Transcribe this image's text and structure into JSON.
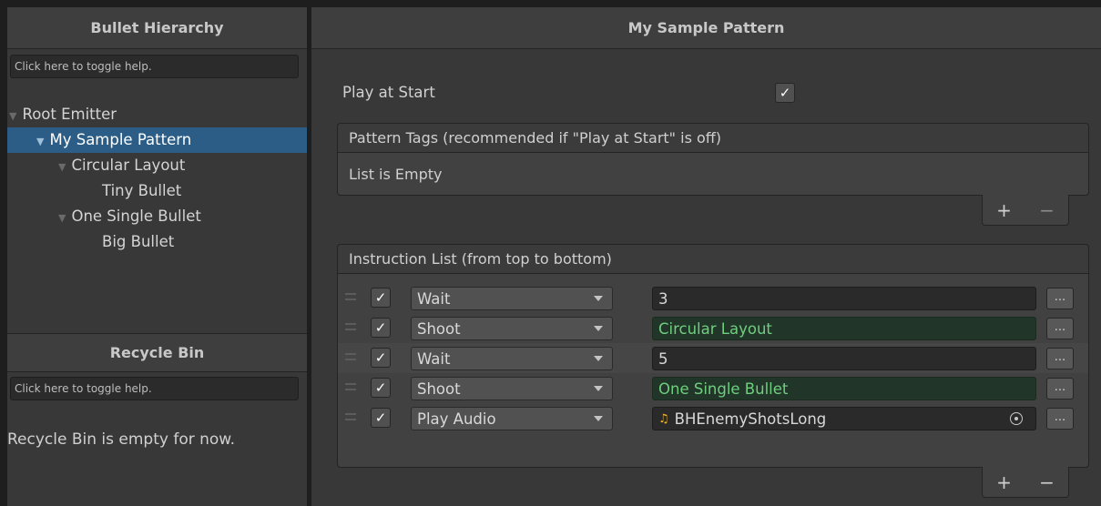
{
  "hierarchy": {
    "title": "Bullet Hierarchy",
    "help": "Click here to toggle help.",
    "items": [
      {
        "label": "Root Emitter"
      },
      {
        "label": "My Sample Pattern"
      },
      {
        "label": "Circular Layout"
      },
      {
        "label": "Tiny Bullet"
      },
      {
        "label": "One Single Bullet"
      },
      {
        "label": "Big Bullet"
      }
    ]
  },
  "recycle": {
    "title": "Recycle Bin",
    "help": "Click here to toggle help.",
    "empty": "Recycle Bin is empty for now."
  },
  "pattern": {
    "title": "My Sample Pattern",
    "play_at_start_label": "Play at Start",
    "play_at_start_checked": true,
    "tags_header": "Pattern Tags (recommended if \"Play at Start\" is off)",
    "tags_empty": "List is Empty",
    "instructions_header": "Instruction List (from top to bottom)",
    "plus": "+",
    "minus": "−",
    "more": "...",
    "instructions": [
      {
        "enabled": true,
        "type": "Wait",
        "value": "3"
      },
      {
        "enabled": true,
        "type": "Shoot",
        "value": "Circular Layout"
      },
      {
        "enabled": true,
        "type": "Wait",
        "value": "5"
      },
      {
        "enabled": true,
        "type": "Shoot",
        "value": "One Single Bullet"
      },
      {
        "enabled": true,
        "type": "Play Audio",
        "value": "BHEnemyShotsLong",
        "icon": "music-note-icon"
      }
    ]
  },
  "colors": {
    "selection": "#2c5d87",
    "green_field_bg": "#213528",
    "green_field_text": "#6fcf7f",
    "audio_icon": "#f0b429"
  }
}
